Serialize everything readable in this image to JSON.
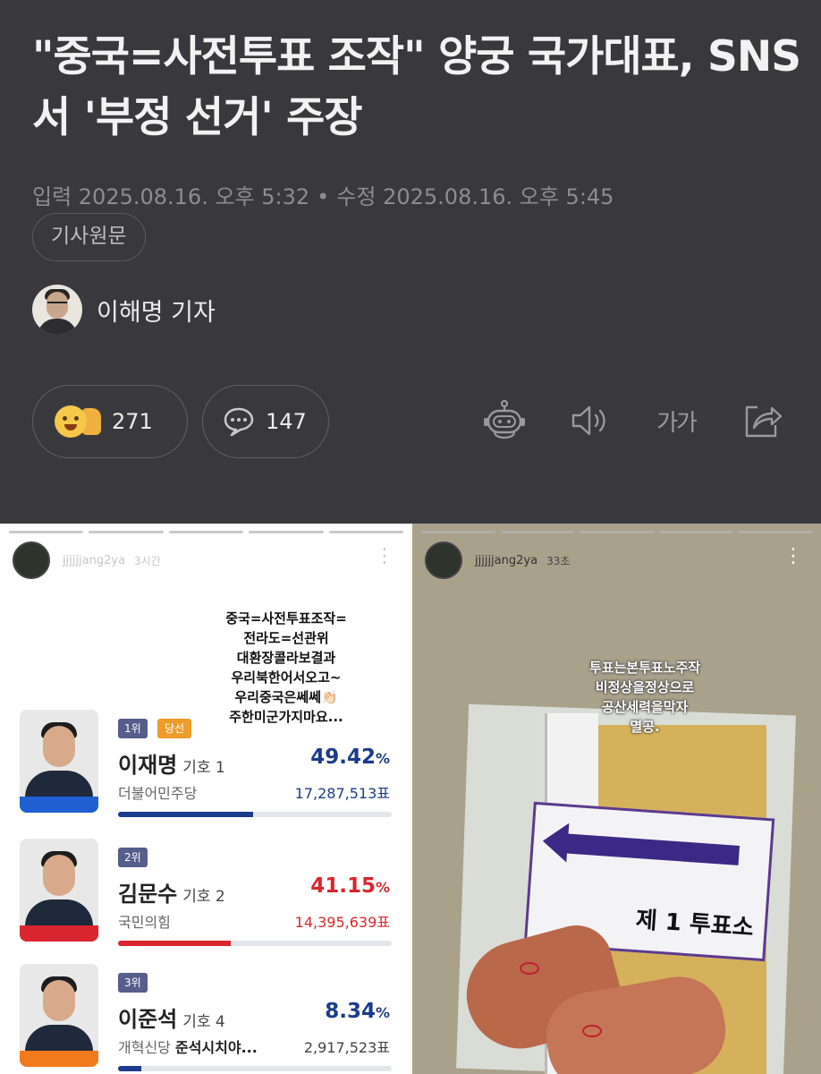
{
  "article": {
    "title": "\"중국=사전투표 조작\" 양궁 국가대표, SNS서 '부정 선거' 주장",
    "input_label": "입력 2025.08.16. 오후 5:32",
    "separator": "•",
    "edit_label": "수정 2025.08.16. 오후 5:45",
    "original_button": "기사원문",
    "reporter": "이해명 기자"
  },
  "actions": {
    "like_count": "271",
    "comment_count": "147",
    "font_size_label": "가가",
    "icons": [
      "robot-summary-icon",
      "speaker-icon",
      "font-size-icon",
      "share-icon"
    ]
  },
  "story_left": {
    "username": "jjjjjjang2ya",
    "time": "3시간",
    "more": "⋮",
    "overlay": [
      "중국=사전투표조작=",
      "전라도=선관위",
      "대환장콜라보결과",
      "우리북한어서오고~",
      "우리중국은쎄쎄👏🏻",
      "주한미군가지마요..."
    ],
    "candidates": [
      {
        "rank": "1위",
        "badge": "당선",
        "name": "이재명",
        "number": "기호 1",
        "party": "더불어민주당",
        "party_extra": "",
        "percent": "49.42",
        "percent_unit": "%",
        "votes": "17,287,513표",
        "share": 0.4942,
        "color": "#1c3b8c",
        "flag": "#1f5fd1"
      },
      {
        "rank": "2위",
        "badge": "",
        "name": "김문수",
        "number": "기호 2",
        "party": "국민의힘",
        "party_extra": "",
        "percent": "41.15",
        "percent_unit": "%",
        "votes": "14,395,639표",
        "share": 0.4115,
        "color": "#d9262f",
        "flag": "#d9262f"
      },
      {
        "rank": "3위",
        "badge": "",
        "name": "이준석",
        "number": "기호 4",
        "party": "개혁신당",
        "party_extra": "준석시치야...",
        "percent": "8.34",
        "percent_unit": "%",
        "votes": "2,917,523표",
        "share": 0.0834,
        "color": "#1c3b8c",
        "flag": "#f07a1e"
      }
    ]
  },
  "story_right": {
    "username": "jjjjjjang2ya",
    "time": "33초",
    "more": "⋮",
    "overlay": [
      "투표는본투표노주작",
      "비정상을정상으로",
      "공산세력을막자",
      "멸공."
    ],
    "poster_label": "제 1 투표소"
  }
}
